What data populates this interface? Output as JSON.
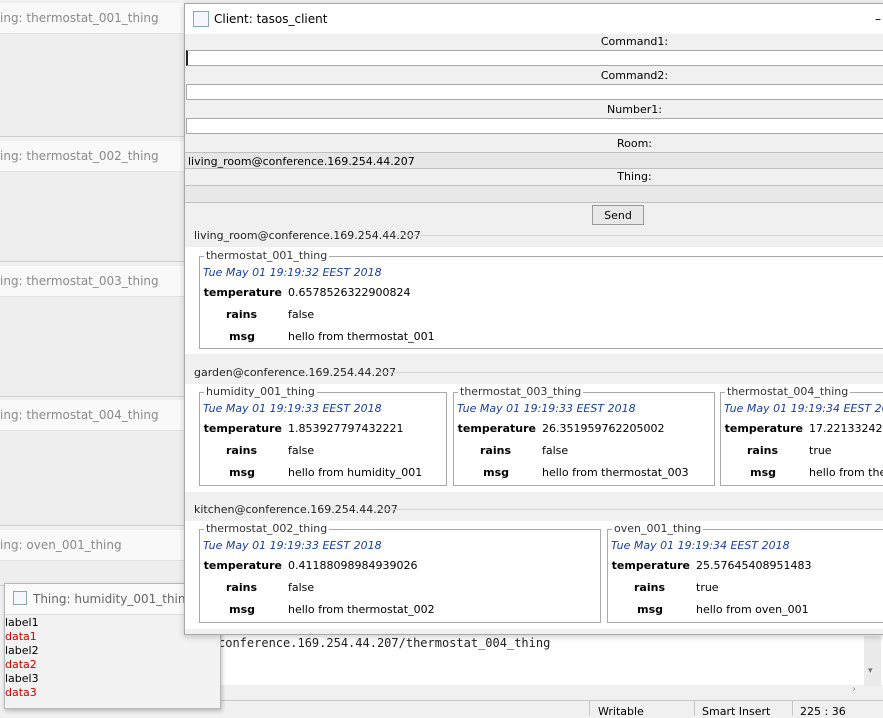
{
  "background_windows": [
    {
      "title": "ing: thermostat_001_thing"
    },
    {
      "title": "ing: thermostat_002_thing"
    },
    {
      "title": "ing: thermostat_003_thing"
    },
    {
      "title": "ing: thermostat_004_thing"
    },
    {
      "title": "ing: oven_001_thing"
    }
  ],
  "humidity_window": {
    "title": "Thing: humidity_001_thing",
    "rows": [
      "label1",
      "data1",
      "label2",
      "data2",
      "label3",
      "data3"
    ]
  },
  "editor": {
    "line": "conference.169.254.44.207/thermostat_004_thing"
  },
  "status": {
    "mode": "Writable",
    "insert": "Smart Insert",
    "position": "225 : 36"
  },
  "client": {
    "title": "Client: tasos_client",
    "minimize": "–",
    "command1_label": "Command1:",
    "command1_value": "",
    "command2_label": "Command2:",
    "command2_value": "",
    "number1_label": "Number1:",
    "number1_value": "",
    "room_label": "Room:",
    "room_value": "living_room@conference.169.254.44.207",
    "thing_label": "Thing:",
    "thing_value": "",
    "send_label": "Send"
  },
  "field_labels": {
    "temperature": "temperature",
    "rains": "rains",
    "msg": "msg"
  },
  "rooms": [
    {
      "name": "living_room@conference.169.254.44.207",
      "things": [
        {
          "name": "thermostat_001_thing",
          "date": "Tue May 01 19:19:32 EEST 2018",
          "temperature": "0.6578526322900824",
          "rains": "false",
          "msg": "hello from thermostat_001"
        }
      ]
    },
    {
      "name": "garden@conference.169.254.44.207",
      "things": [
        {
          "name": "humidity_001_thing",
          "date": "Tue May 01 19:19:33 EEST 2018",
          "temperature": "1.853927797432221",
          "rains": "false",
          "msg": "hello from humidity_001"
        },
        {
          "name": "thermostat_003_thing",
          "date": "Tue May 01 19:19:33 EEST 2018",
          "temperature": "26.351959762205002",
          "rains": "false",
          "msg": "hello from thermostat_003"
        },
        {
          "name": "thermostat_004_thing",
          "date": "Tue May 01 19:19:34 EEST 2018",
          "temperature": "17.2213324224",
          "rains": "true",
          "msg": "hello from therm"
        }
      ]
    },
    {
      "name": "kitchen@conference.169.254.44.207",
      "things": [
        {
          "name": "thermostat_002_thing",
          "date": "Tue May 01 19:19:33 EEST 2018",
          "temperature": "0.41188098984939026",
          "rains": "false",
          "msg": "hello from thermostat_002"
        },
        {
          "name": "oven_001_thing",
          "date": "Tue May 01 19:19:34 EEST 2018",
          "temperature": "25.57645408951483",
          "rains": "true",
          "msg": "hello from oven_001"
        }
      ]
    }
  ]
}
